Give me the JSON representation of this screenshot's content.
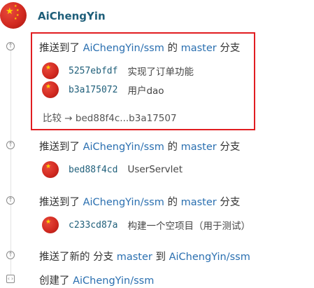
{
  "user": {
    "name": "AiChengYin"
  },
  "events": [
    {
      "prefix": "推送到了",
      "repo": "AiChengYin/ssm",
      "mid": "的",
      "branch": "master",
      "suffix": "分支",
      "commits": [
        {
          "sha": "5257ebfdf",
          "message": "实现了订单功能"
        },
        {
          "sha": "b3a175072",
          "message": "用户dao"
        }
      ],
      "compare_label": "比较",
      "compare_arrow": "→",
      "compare_range": "bed88f4c...b3a17507"
    },
    {
      "prefix": "推送到了",
      "repo": "AiChengYin/ssm",
      "mid": "的",
      "branch": "master",
      "suffix": "分支",
      "commits": [
        {
          "sha": "bed88f4cd",
          "message": "UserServlet"
        }
      ]
    },
    {
      "prefix": "推送到了",
      "repo": "AiChengYin/ssm",
      "mid": "的",
      "branch": "master",
      "suffix": "分支",
      "commits": [
        {
          "sha": "c233cd87a",
          "message": "构建一个空项目（用于测试）"
        }
      ]
    },
    {
      "prefix": "推送了新的 分支",
      "branch": "master",
      "mid": "到",
      "repo": "AiChengYin/ssm"
    },
    {
      "prefix": "创建了",
      "repo": "AiChengYin/ssm"
    }
  ],
  "icons": {
    "push": "arrow-up-circle-icon",
    "create": "code-icon",
    "avatar": "flag-avatar"
  },
  "colors": {
    "username": "#1f5f7a",
    "link": "#2a6fb0",
    "highlight": "#e11d21"
  }
}
